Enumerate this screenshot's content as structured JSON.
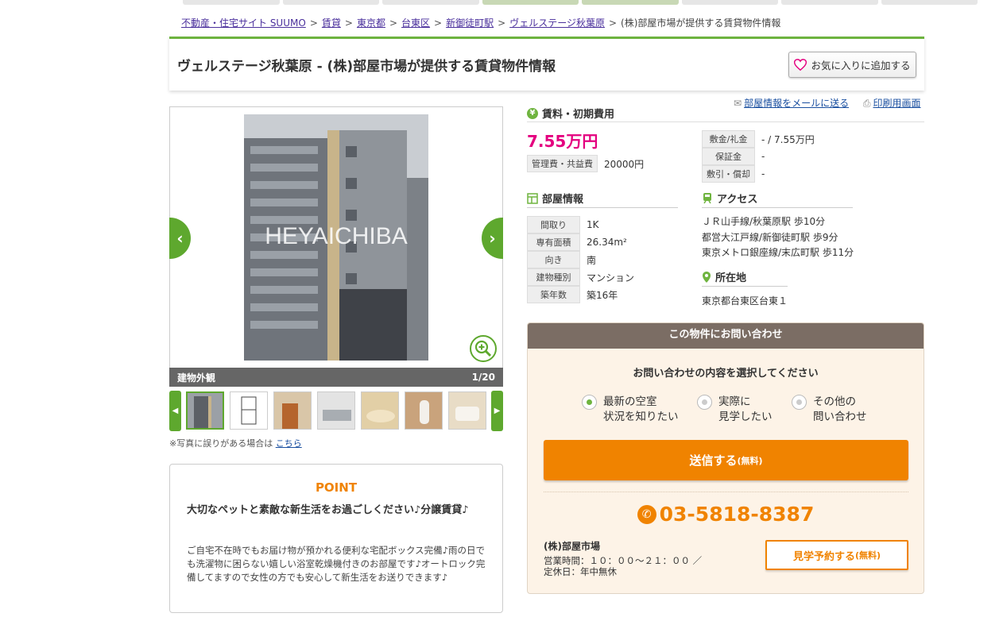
{
  "breadcrumb": [
    {
      "label": "不動産・住宅サイト SUUMO",
      "link": true
    },
    {
      "label": "賃貸",
      "link": true
    },
    {
      "label": "東京都",
      "link": true
    },
    {
      "label": "台東区",
      "link": true
    },
    {
      "label": "新御徒町駅",
      "link": true
    },
    {
      "label": "ヴェルステージ秋葉原",
      "link": true
    },
    {
      "label": "(株)部屋市場が提供する賃貸物件情報",
      "link": false
    }
  ],
  "page_title": "ヴェルステージ秋葉原 - (株)部屋市場が提供する賃貸物件情報",
  "favorite_label": "お気に入りに追加する",
  "gallery": {
    "watermark": "HEYAICHIBA",
    "caption": "建物外観",
    "counter": "1/20",
    "prev_icon": "chevron-left-icon",
    "next_icon": "chevron-right-icon",
    "thumbnail_count": 7,
    "note": "※写真に誤りがある場合は",
    "note_link": "こちら"
  },
  "point": {
    "title": "POINT",
    "lead": "大切なペットと素敵な新生活をお過ごしください♪分譲賃貸♪",
    "body": "ご自宅不在時でもお届け物が預かれる便利な宅配ボックス完備♪雨の日でも洗濯物に困らない嬉しい浴室乾燥機付きのお部屋です♪オートロック完備してますので女性の方でも安心して新生活をお送りできます♪"
  },
  "links": {
    "mail": "部屋情報をメールに送る",
    "print": "印刷用画面"
  },
  "fees": {
    "heading": "賃料・初期費用",
    "rent": "7.55万円",
    "management_label": "管理費・共益費",
    "management_value": "20000円",
    "deposit_label": "敷金/礼金",
    "deposit_value": "- / 7.55万円",
    "guarantee_label": "保証金",
    "guarantee_value": "-",
    "discount_label": "敷引・償却",
    "discount_value": "-"
  },
  "room": {
    "heading": "部屋情報",
    "rows": [
      {
        "label": "間取り",
        "value": "1K"
      },
      {
        "label": "専有面積",
        "value": "26.34m²"
      },
      {
        "label": "向き",
        "value": "南"
      },
      {
        "label": "建物種別",
        "value": "マンション"
      },
      {
        "label": "築年数",
        "value": "築16年"
      }
    ]
  },
  "access": {
    "heading": "アクセス",
    "lines": [
      "ＪＲ山手線/秋葉原駅 歩10分",
      "都営大江戸線/新御徒町駅 歩9分",
      "東京メトロ銀座線/末広町駅 歩11分"
    ]
  },
  "location": {
    "heading": "所在地",
    "address": "東京都台東区台東１"
  },
  "inquiry": {
    "heading": "この物件にお問い合わせ",
    "question": "お問い合わせの内容を選択してください",
    "options": [
      {
        "line1": "最新の空室",
        "line2": "状況を知りたい",
        "selected": true
      },
      {
        "line1": "実際に",
        "line2": "見学したい",
        "selected": false
      },
      {
        "line1": "その他の",
        "line2": "問い合わせ",
        "selected": false
      }
    ],
    "send_label": "送信する",
    "send_sub": "(無料)",
    "phone": "03-5818-8387",
    "company": "(株)部屋市場",
    "hours": "営業時間：１０：００～２１：００ ／",
    "holiday": "定休日：年中無休",
    "visit_label": "見学予約する",
    "visit_sub": "(無料)"
  },
  "colors": {
    "accent_green": "#6db33f",
    "rent_pink": "#e4007f",
    "cta_orange": "#f08300"
  }
}
